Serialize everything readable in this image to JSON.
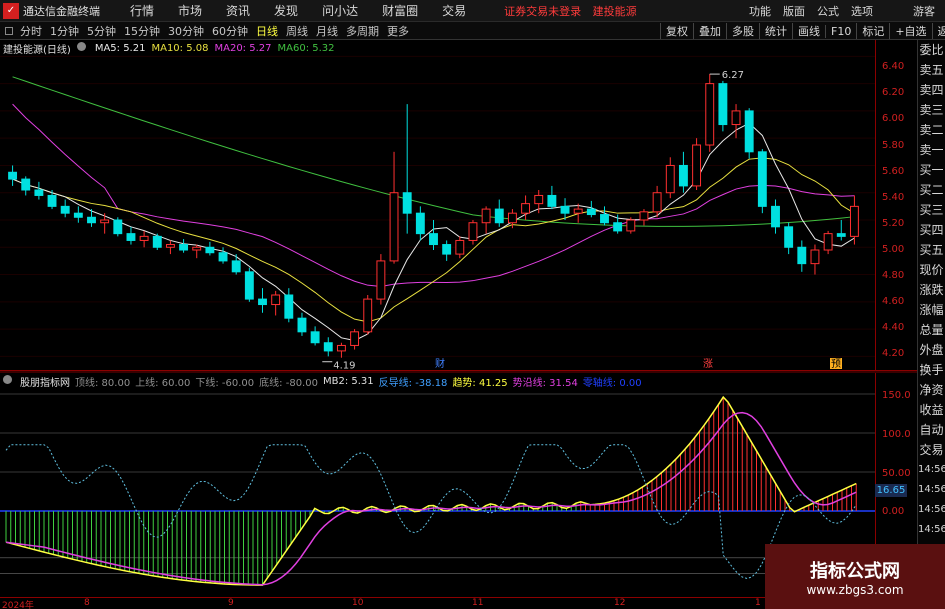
{
  "titlebar": {
    "app_title": "通达信金融终端",
    "menu": [
      "行情",
      "市场",
      "资讯",
      "发现",
      "问小达",
      "财富圈",
      "交易"
    ],
    "notice": [
      "证券交易未登录",
      "建投能源"
    ],
    "right_menu": [
      "功能",
      "版面",
      "公式",
      "选项"
    ],
    "guest": "游客"
  },
  "periodbar": {
    "periods": [
      "分时",
      "1分钟",
      "5分钟",
      "15分钟",
      "30分钟",
      "60分钟",
      "日线",
      "周线",
      "月线",
      "多周期",
      "更多"
    ],
    "active": "日线",
    "tools": [
      "复权",
      "叠加",
      "多股",
      "统计",
      "画线",
      "F10",
      "标记",
      "+自选",
      "返回"
    ]
  },
  "main_indicator": {
    "stock": "建投能源(日线)",
    "ma5": "MA5: 5.21",
    "ma10": "MA10: 5.08",
    "ma20": "MA20: 5.27",
    "ma60": "MA60: 5.32",
    "high_label": "6.27",
    "low_label": "4.19",
    "markers": [
      "财",
      "涨",
      "预"
    ]
  },
  "sub_indicator": {
    "name": "股朋指标网",
    "l1": "顶线: 80.00",
    "l2": "上线: 60.00",
    "l3": "下线: -60.00",
    "l4": "底线: -80.00",
    "l5": "MB2: 5.31",
    "l6": "反导线: -38.18",
    "l7": "趋势: 41.25",
    "l8": "势沿线: 31.54",
    "l9": "零轴线: 0.00",
    "tag": "16.65"
  },
  "price_axis": [
    "6.40",
    "6.20",
    "6.00",
    "5.80",
    "5.60",
    "5.40",
    "5.20",
    "5.00",
    "4.80",
    "4.60",
    "4.40",
    "4.20"
  ],
  "sub_axis": [
    "150.0",
    "100.0",
    "50.00",
    "0.00"
  ],
  "x_axis": [
    "2024年",
    "8",
    "9",
    "10",
    "11",
    "12",
    "1"
  ],
  "side_labels": [
    "委比",
    "卖五",
    "卖四",
    "卖三",
    "卖二",
    "卖一",
    "买一",
    "买二",
    "买三",
    "买四",
    "买五",
    "现价",
    "涨跌",
    "涨幅",
    "总量",
    "外盘",
    "换手",
    "净资",
    "收益",
    "自动",
    "交易",
    "14:56",
    "14:56",
    "14:56",
    "14:56",
    "14:56",
    "14:56",
    "14:56",
    "14:56"
  ],
  "watermark": {
    "line1": "指标公式网",
    "line2": "www.zbgs3.com"
  },
  "colors": {
    "up": "#ff3030",
    "down": "#00e0e0",
    "ma5": "#e8e8e8",
    "ma10": "#e8e040",
    "ma20": "#e040e0",
    "ma60": "#40c040"
  },
  "chart_data": {
    "type": "candlestick",
    "price_range": [
      4.1,
      6.52
    ],
    "candles": [
      [
        5.55,
        5.6,
        5.45,
        5.5
      ],
      [
        5.5,
        5.52,
        5.38,
        5.42
      ],
      [
        5.42,
        5.48,
        5.35,
        5.38
      ],
      [
        5.38,
        5.42,
        5.28,
        5.3
      ],
      [
        5.3,
        5.35,
        5.22,
        5.25
      ],
      [
        5.25,
        5.3,
        5.18,
        5.22
      ],
      [
        5.22,
        5.28,
        5.15,
        5.18
      ],
      [
        5.18,
        5.25,
        5.1,
        5.2
      ],
      [
        5.2,
        5.22,
        5.08,
        5.1
      ],
      [
        5.1,
        5.15,
        5.02,
        5.05
      ],
      [
        5.05,
        5.12,
        5.0,
        5.08
      ],
      [
        5.08,
        5.1,
        4.98,
        5.0
      ],
      [
        5.0,
        5.05,
        4.95,
        5.02
      ],
      [
        5.02,
        5.06,
        4.96,
        4.98
      ],
      [
        4.98,
        5.02,
        4.92,
        5.0
      ],
      [
        5.0,
        5.04,
        4.94,
        4.96
      ],
      [
        4.96,
        5.0,
        4.88,
        4.9
      ],
      [
        4.9,
        4.95,
        4.8,
        4.82
      ],
      [
        4.82,
        4.85,
        4.6,
        4.62
      ],
      [
        4.62,
        4.7,
        4.52,
        4.58
      ],
      [
        4.58,
        4.68,
        4.5,
        4.65
      ],
      [
        4.65,
        4.7,
        4.45,
        4.48
      ],
      [
        4.48,
        4.52,
        4.35,
        4.38
      ],
      [
        4.38,
        4.42,
        4.28,
        4.3
      ],
      [
        4.3,
        4.34,
        4.2,
        4.24
      ],
      [
        4.24,
        4.3,
        4.19,
        4.28
      ],
      [
        4.28,
        4.4,
        4.25,
        4.38
      ],
      [
        4.38,
        4.65,
        4.36,
        4.62
      ],
      [
        4.62,
        4.95,
        4.58,
        4.9
      ],
      [
        4.9,
        5.7,
        4.88,
        5.4
      ],
      [
        5.4,
        6.05,
        5.1,
        5.25
      ],
      [
        5.25,
        5.3,
        5.05,
        5.1
      ],
      [
        5.1,
        5.2,
        4.98,
        5.02
      ],
      [
        5.02,
        5.05,
        4.9,
        4.95
      ],
      [
        4.95,
        5.08,
        4.92,
        5.05
      ],
      [
        5.05,
        5.2,
        5.02,
        5.18
      ],
      [
        5.18,
        5.3,
        5.1,
        5.28
      ],
      [
        5.28,
        5.35,
        5.15,
        5.18
      ],
      [
        5.18,
        5.28,
        5.14,
        5.25
      ],
      [
        5.25,
        5.38,
        5.2,
        5.32
      ],
      [
        5.32,
        5.42,
        5.25,
        5.38
      ],
      [
        5.38,
        5.45,
        5.28,
        5.3
      ],
      [
        5.3,
        5.36,
        5.2,
        5.25
      ],
      [
        5.25,
        5.32,
        5.18,
        5.28
      ],
      [
        5.28,
        5.34,
        5.22,
        5.24
      ],
      [
        5.24,
        5.3,
        5.16,
        5.18
      ],
      [
        5.18,
        5.24,
        5.1,
        5.12
      ],
      [
        5.12,
        5.22,
        5.1,
        5.2
      ],
      [
        5.2,
        5.28,
        5.16,
        5.26
      ],
      [
        5.26,
        5.45,
        5.22,
        5.4
      ],
      [
        5.4,
        5.66,
        5.36,
        5.6
      ],
      [
        5.6,
        5.7,
        5.4,
        5.45
      ],
      [
        5.45,
        5.8,
        5.42,
        5.75
      ],
      [
        5.75,
        6.27,
        5.7,
        6.2
      ],
      [
        6.2,
        6.22,
        5.85,
        5.9
      ],
      [
        5.9,
        6.05,
        5.8,
        6.0
      ],
      [
        6.0,
        6.02,
        5.65,
        5.7
      ],
      [
        5.7,
        5.72,
        5.25,
        5.3
      ],
      [
        5.3,
        5.35,
        5.1,
        5.15
      ],
      [
        5.15,
        5.18,
        4.95,
        5.0
      ],
      [
        5.0,
        5.05,
        4.82,
        4.88
      ],
      [
        4.88,
        5.02,
        4.8,
        4.98
      ],
      [
        4.98,
        5.12,
        4.95,
        5.1
      ],
      [
        5.1,
        5.2,
        5.05,
        5.08
      ],
      [
        5.08,
        5.38,
        5.02,
        5.3
      ]
    ]
  }
}
